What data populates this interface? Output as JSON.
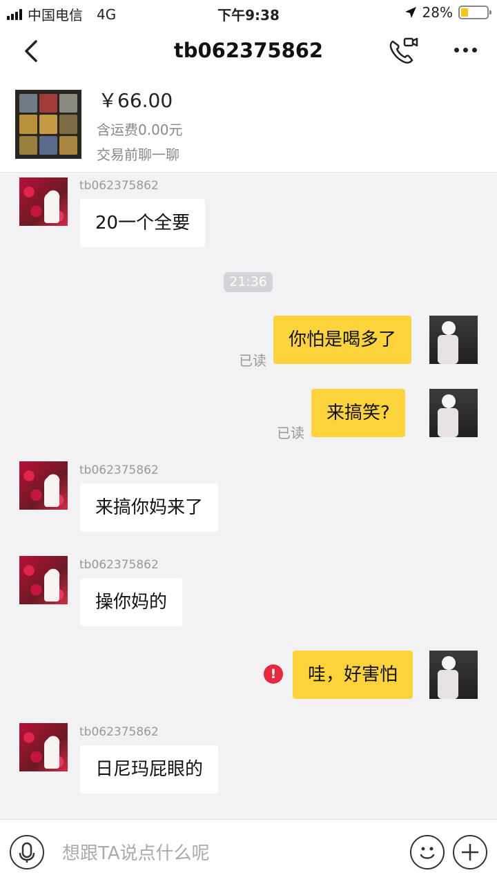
{
  "status_bar": {
    "carrier": "中国电信",
    "network": "4G",
    "time": "下午9:38",
    "battery": "28%",
    "battery_level": 0.28
  },
  "nav": {
    "title": "tb062375862",
    "back_icon": "chevron-left-icon",
    "call_icon": "phone-video-icon",
    "more_icon": "more-dots-icon"
  },
  "product": {
    "price": "￥66.00",
    "shipping": "含运费0.00元",
    "pre_trade": "交易前聊一聊"
  },
  "messages": [
    {
      "side": "in",
      "sender": "tb062375862",
      "text": "20一个全要"
    },
    {
      "type": "timestamp",
      "text": "21:36"
    },
    {
      "side": "out",
      "text": "你怕是喝多了",
      "status": "已读"
    },
    {
      "side": "out",
      "text": "来搞笑?",
      "status": "已读"
    },
    {
      "side": "in",
      "sender": "tb062375862",
      "text": "来搞你妈来了"
    },
    {
      "side": "in",
      "sender": "tb062375862",
      "text": "操你妈的"
    },
    {
      "side": "out",
      "text": "哇，好害怕",
      "status": "!"
    },
    {
      "side": "in",
      "sender": "tb062375862",
      "text": "日尼玛屁眼的"
    }
  ],
  "input": {
    "placeholder": "想跟TA说点什么呢",
    "mic_icon": "microphone-icon",
    "emoji_icon": "smiley-icon",
    "plus_icon": "plus-icon"
  },
  "colors": {
    "bubble_out": "#fcd33a",
    "bubble_in": "#ffffff",
    "background": "#f2f2f5",
    "error": "#e8293d"
  }
}
